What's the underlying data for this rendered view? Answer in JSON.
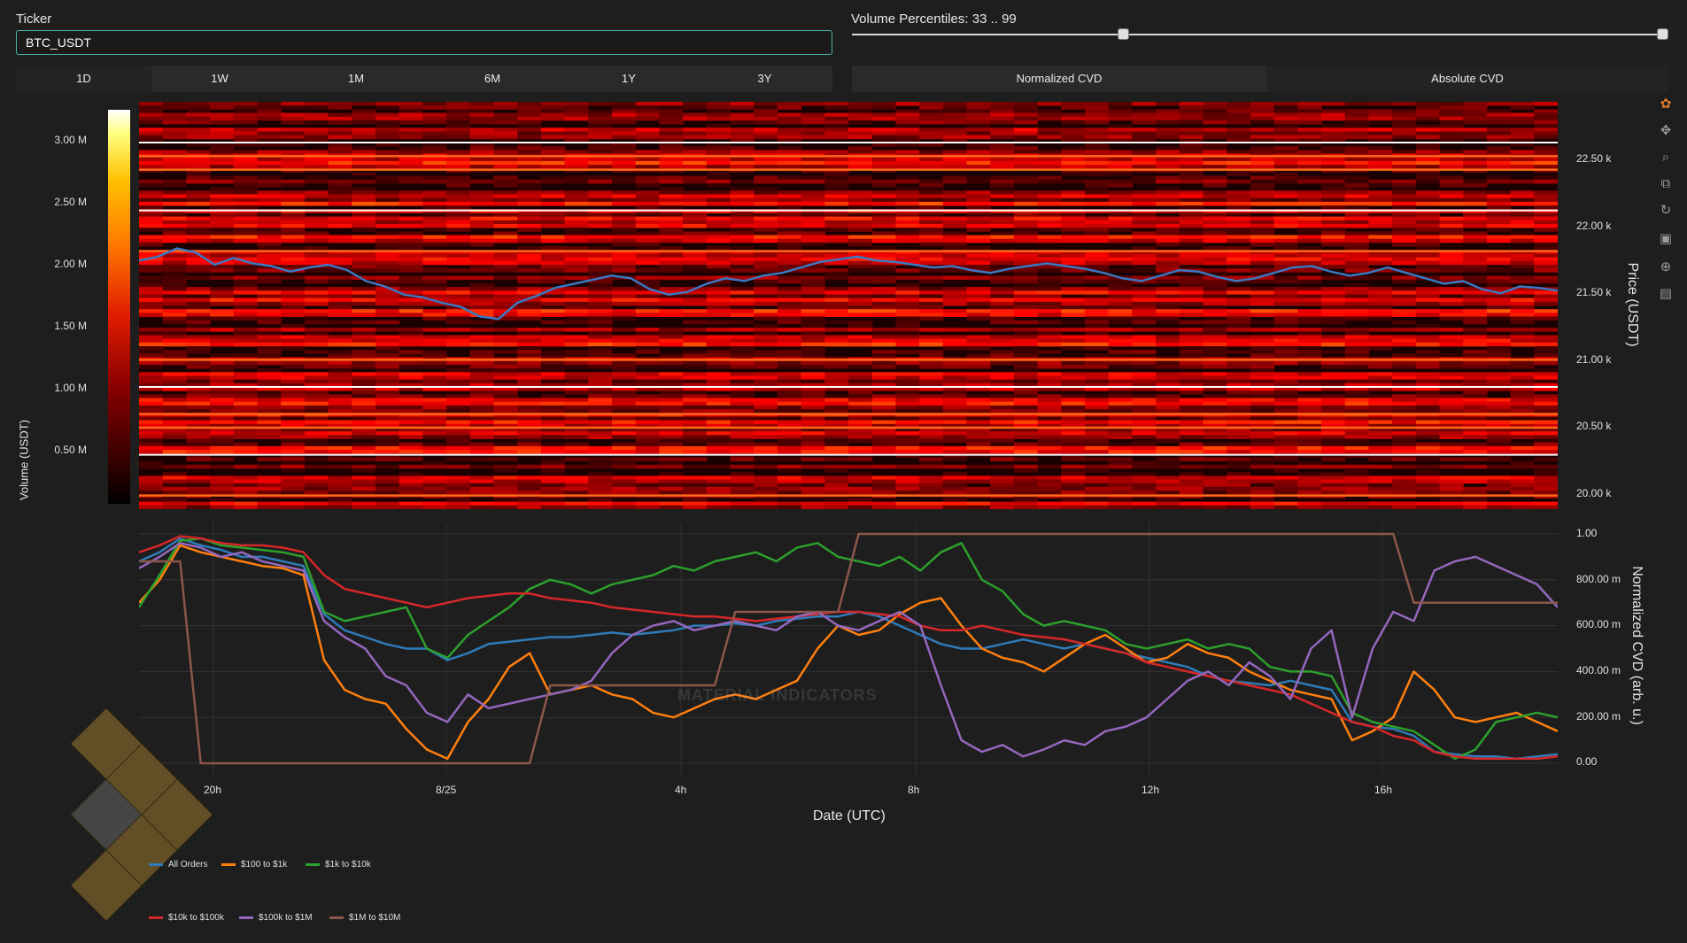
{
  "ticker": {
    "label": "Ticker",
    "value": "BTC_USDT"
  },
  "volume_percentiles": {
    "label": "Volume Percentiles: 33 .. 99",
    "low": 33,
    "high": 99
  },
  "timeframes": [
    "1D",
    "1W",
    "1M",
    "6M",
    "1Y",
    "3Y"
  ],
  "active_timeframe": "1D",
  "cvd_modes": [
    "Normalized CVD",
    "Absolute CVD"
  ],
  "active_cvd_mode": "Normalized CVD",
  "watermark_text": "MATERIAL INDICATORS",
  "colorbar": {
    "title": "Volume (USDT)",
    "ticks": [
      "3.00 M",
      "2.50 M",
      "2.00 M",
      "1.50 M",
      "1.00 M",
      "0.50 M"
    ]
  },
  "x_axis": {
    "title": "Date (UTC)",
    "ticks": [
      "20h",
      "8/25",
      "4h",
      "8h",
      "12h",
      "16h"
    ]
  },
  "chart_data": [
    {
      "type": "heatmap",
      "ylabel": "Price (USDT)",
      "y_ticks": [
        "22.50 k",
        "22.00 k",
        "21.50 k",
        "21.00 k",
        "20.50 k",
        "20.00 k"
      ],
      "ylim": [
        19900,
        22900
      ],
      "colorscale": "hot",
      "zlim": [
        0,
        3300000
      ],
      "bright_levels": [
        22600,
        22500,
        22400,
        22100,
        21800,
        21000,
        20800,
        20600,
        20500,
        20300,
        20000
      ],
      "series": [
        {
          "name": "Price",
          "color": "#3a78c2",
          "values": [
            21730,
            21760,
            21820,
            21790,
            21700,
            21750,
            21710,
            21690,
            21650,
            21680,
            21700,
            21660,
            21580,
            21540,
            21480,
            21460,
            21420,
            21390,
            21320,
            21300,
            21420,
            21470,
            21530,
            21560,
            21590,
            21620,
            21600,
            21520,
            21480,
            21500,
            21560,
            21600,
            21580,
            21620,
            21640,
            21680,
            21720,
            21740,
            21760,
            21730,
            21720,
            21700,
            21680,
            21690,
            21660,
            21640,
            21670,
            21690,
            21710,
            21690,
            21670,
            21640,
            21600,
            21580,
            21620,
            21660,
            21650,
            21610,
            21580,
            21600,
            21640,
            21680,
            21690,
            21650,
            21620,
            21640,
            21680,
            21640,
            21600,
            21560,
            21580,
            21520,
            21490,
            21540,
            21530,
            21510
          ]
        }
      ]
    },
    {
      "type": "line",
      "ylabel": "Normalized CVD (arb. u.)",
      "y_ticks": [
        "1.00",
        "800.00 m",
        "600.00 m",
        "400.00 m",
        "200.00 m",
        "0.00"
      ],
      "ylim": [
        -0.05,
        1.05
      ],
      "series": [
        {
          "name": "All Orders",
          "color": "#2f7ab8",
          "values": [
            0.88,
            0.92,
            0.98,
            0.95,
            0.93,
            0.9,
            0.9,
            0.88,
            0.86,
            0.65,
            0.58,
            0.55,
            0.52,
            0.5,
            0.5,
            0.45,
            0.48,
            0.52,
            0.53,
            0.54,
            0.55,
            0.55,
            0.56,
            0.57,
            0.56,
            0.57,
            0.58,
            0.6,
            0.6,
            0.61,
            0.6,
            0.62,
            0.63,
            0.64,
            0.64,
            0.66,
            0.64,
            0.6,
            0.56,
            0.52,
            0.5,
            0.5,
            0.52,
            0.54,
            0.52,
            0.5,
            0.52,
            0.5,
            0.48,
            0.46,
            0.44,
            0.42,
            0.38,
            0.36,
            0.35,
            0.34,
            0.36,
            0.34,
            0.32,
            0.18,
            0.16,
            0.15,
            0.12,
            0.05,
            0.04,
            0.03,
            0.03,
            0.02,
            0.03,
            0.04
          ]
        },
        {
          "name": "$100 to $1k",
          "color": "#ff7f0e",
          "values": [
            0.7,
            0.8,
            0.95,
            0.92,
            0.9,
            0.88,
            0.86,
            0.85,
            0.82,
            0.45,
            0.32,
            0.28,
            0.26,
            0.15,
            0.06,
            0.02,
            0.18,
            0.28,
            0.42,
            0.48,
            0.3,
            0.32,
            0.34,
            0.3,
            0.28,
            0.22,
            0.2,
            0.24,
            0.28,
            0.3,
            0.28,
            0.32,
            0.36,
            0.5,
            0.6,
            0.56,
            0.58,
            0.65,
            0.7,
            0.72,
            0.6,
            0.5,
            0.46,
            0.44,
            0.4,
            0.46,
            0.52,
            0.56,
            0.5,
            0.44,
            0.46,
            0.52,
            0.48,
            0.46,
            0.4,
            0.36,
            0.32,
            0.3,
            0.28,
            0.1,
            0.14,
            0.2,
            0.4,
            0.32,
            0.2,
            0.18,
            0.2,
            0.22,
            0.18,
            0.14
          ]
        },
        {
          "name": "$1k to $10k",
          "color": "#2ca02c",
          "values": [
            0.68,
            0.82,
            0.97,
            0.98,
            0.95,
            0.94,
            0.93,
            0.92,
            0.9,
            0.66,
            0.62,
            0.64,
            0.66,
            0.68,
            0.5,
            0.46,
            0.56,
            0.62,
            0.68,
            0.76,
            0.8,
            0.78,
            0.74,
            0.78,
            0.8,
            0.82,
            0.86,
            0.84,
            0.88,
            0.9,
            0.92,
            0.88,
            0.94,
            0.96,
            0.9,
            0.88,
            0.86,
            0.9,
            0.84,
            0.92,
            0.96,
            0.8,
            0.75,
            0.65,
            0.6,
            0.62,
            0.6,
            0.58,
            0.52,
            0.5,
            0.52,
            0.54,
            0.5,
            0.52,
            0.5,
            0.42,
            0.4,
            0.4,
            0.38,
            0.22,
            0.18,
            0.16,
            0.14,
            0.08,
            0.02,
            0.06,
            0.18,
            0.2,
            0.22,
            0.2
          ]
        },
        {
          "name": "$10k to $100k",
          "color": "#d62728",
          "values": [
            0.92,
            0.95,
            0.99,
            0.98,
            0.96,
            0.95,
            0.95,
            0.94,
            0.92,
            0.82,
            0.76,
            0.74,
            0.72,
            0.7,
            0.68,
            0.7,
            0.72,
            0.73,
            0.74,
            0.74,
            0.72,
            0.71,
            0.7,
            0.68,
            0.67,
            0.66,
            0.65,
            0.64,
            0.64,
            0.63,
            0.62,
            0.63,
            0.64,
            0.65,
            0.66,
            0.66,
            0.65,
            0.64,
            0.6,
            0.58,
            0.58,
            0.6,
            0.58,
            0.56,
            0.55,
            0.54,
            0.52,
            0.5,
            0.48,
            0.44,
            0.42,
            0.4,
            0.38,
            0.36,
            0.34,
            0.32,
            0.3,
            0.26,
            0.22,
            0.18,
            0.16,
            0.12,
            0.1,
            0.05,
            0.03,
            0.02,
            0.02,
            0.02,
            0.02,
            0.03
          ]
        },
        {
          "name": "$100k to $1M",
          "color": "#9467bd",
          "values": [
            0.85,
            0.9,
            0.96,
            0.94,
            0.9,
            0.92,
            0.88,
            0.86,
            0.84,
            0.62,
            0.55,
            0.5,
            0.38,
            0.34,
            0.22,
            0.18,
            0.3,
            0.24,
            0.26,
            0.28,
            0.3,
            0.32,
            0.36,
            0.48,
            0.56,
            0.6,
            0.62,
            0.58,
            0.6,
            0.62,
            0.6,
            0.58,
            0.64,
            0.66,
            0.6,
            0.58,
            0.62,
            0.66,
            0.6,
            0.34,
            0.1,
            0.05,
            0.08,
            0.03,
            0.06,
            0.1,
            0.08,
            0.14,
            0.16,
            0.2,
            0.28,
            0.36,
            0.4,
            0.34,
            0.44,
            0.38,
            0.28,
            0.5,
            0.58,
            0.2,
            0.5,
            0.66,
            0.62,
            0.84,
            0.88,
            0.9,
            0.86,
            0.82,
            0.78,
            0.68
          ]
        },
        {
          "name": "$1M to $10M",
          "color": "#8c564b",
          "values": [
            0.88,
            0.88,
            0.88,
            0.0,
            0.0,
            0.0,
            0.0,
            0.0,
            0.0,
            0.0,
            0.0,
            0.0,
            0.0,
            0.0,
            0.0,
            0.0,
            0.0,
            0.0,
            0.0,
            0.0,
            0.34,
            0.34,
            0.34,
            0.34,
            0.34,
            0.34,
            0.34,
            0.34,
            0.34,
            0.66,
            0.66,
            0.66,
            0.66,
            0.66,
            0.66,
            1.0,
            1.0,
            1.0,
            1.0,
            1.0,
            1.0,
            1.0,
            1.0,
            1.0,
            1.0,
            1.0,
            1.0,
            1.0,
            1.0,
            1.0,
            1.0,
            1.0,
            1.0,
            1.0,
            1.0,
            1.0,
            1.0,
            1.0,
            1.0,
            1.0,
            1.0,
            1.0,
            0.7,
            0.7,
            0.7,
            0.7,
            0.7,
            0.7,
            0.7,
            0.7
          ]
        }
      ]
    }
  ]
}
